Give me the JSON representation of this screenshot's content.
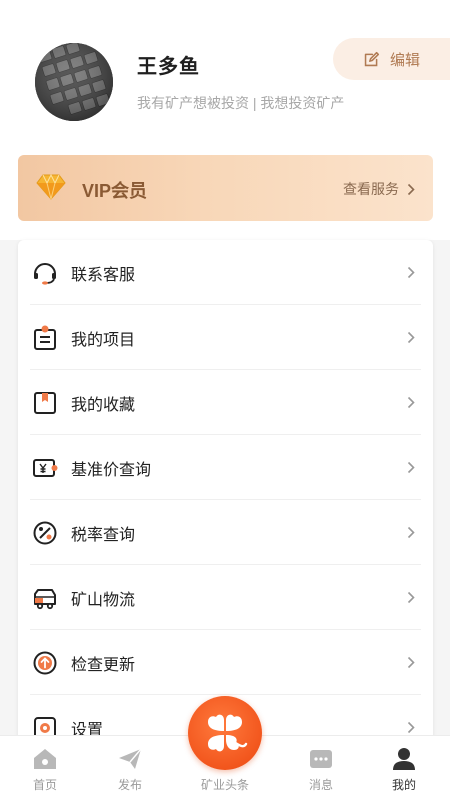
{
  "profile": {
    "name": "王多鱼",
    "tagline": "我有矿产想被投资 | 我想投资矿产",
    "edit_label": "编辑"
  },
  "vip": {
    "title": "VIP会员",
    "link": "查看服务"
  },
  "menu": [
    {
      "label": "联系客服",
      "icon": "headset-icon"
    },
    {
      "label": "我的项目",
      "icon": "project-list-icon"
    },
    {
      "label": "我的收藏",
      "icon": "bookmark-icon"
    },
    {
      "label": "基准价查询",
      "icon": "yen-price-icon"
    },
    {
      "label": "税率查询",
      "icon": "percent-icon"
    },
    {
      "label": "矿山物流",
      "icon": "truck-icon"
    },
    {
      "label": "检查更新",
      "icon": "upload-arrow-icon"
    },
    {
      "label": "设置",
      "icon": "gear-icon"
    }
  ],
  "tabs": [
    {
      "label": "首页",
      "icon": "home-icon",
      "active": false
    },
    {
      "label": "发布",
      "icon": "send-icon",
      "active": false
    },
    {
      "label": "矿业头条",
      "icon": "clover-icon",
      "active": false
    },
    {
      "label": "消息",
      "icon": "message-icon",
      "active": false
    },
    {
      "label": "我的",
      "icon": "user-icon",
      "active": true
    }
  ],
  "colors": {
    "accent": "#f2561d",
    "vip_gold": "#f2c7a2",
    "icon_orange": "#f07a48"
  }
}
